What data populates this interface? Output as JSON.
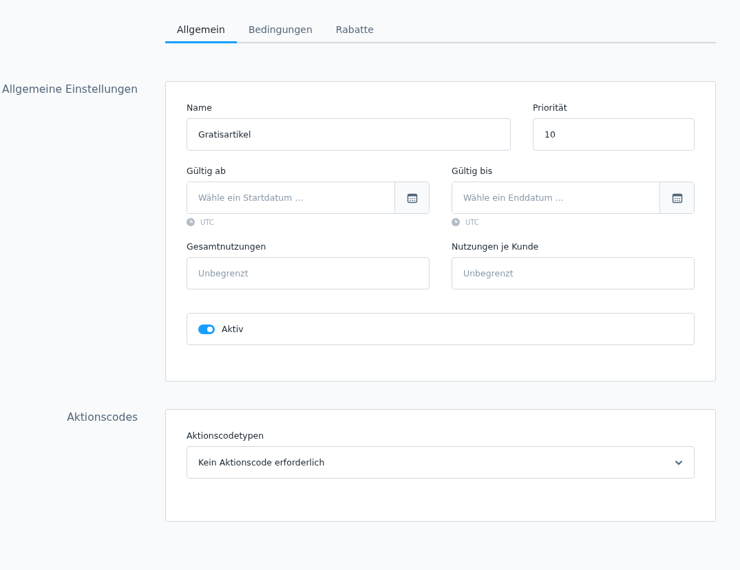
{
  "tabs": [
    {
      "label": "Allgemein",
      "selected": true
    },
    {
      "label": "Bedingungen",
      "selected": false
    },
    {
      "label": "Rabatte",
      "selected": false
    }
  ],
  "general": {
    "title": "Allgemeine Einstellungen",
    "name": {
      "label": "Name",
      "value": "Gratisartikel"
    },
    "priority": {
      "label": "Priorität",
      "value": "10"
    },
    "valid_from": {
      "label": "Gültig ab",
      "placeholder": "Wähle ein Startdatum ...",
      "timezone": "UTC"
    },
    "valid_until": {
      "label": "Gültig bis",
      "placeholder": "Wähle ein Enddatum ...",
      "timezone": "UTC"
    },
    "total_uses": {
      "label": "Gesamtnutzungen",
      "placeholder": "Unbegrenzt"
    },
    "uses_per_customer": {
      "label": "Nutzungen je Kunde",
      "placeholder": "Unbegrenzt"
    },
    "active": {
      "label": "Aktiv",
      "on": true
    }
  },
  "codes": {
    "title": "Aktionscodes",
    "type": {
      "label": "Aktionscodetypen",
      "value": "Kein Aktionscode erforderlich"
    }
  }
}
